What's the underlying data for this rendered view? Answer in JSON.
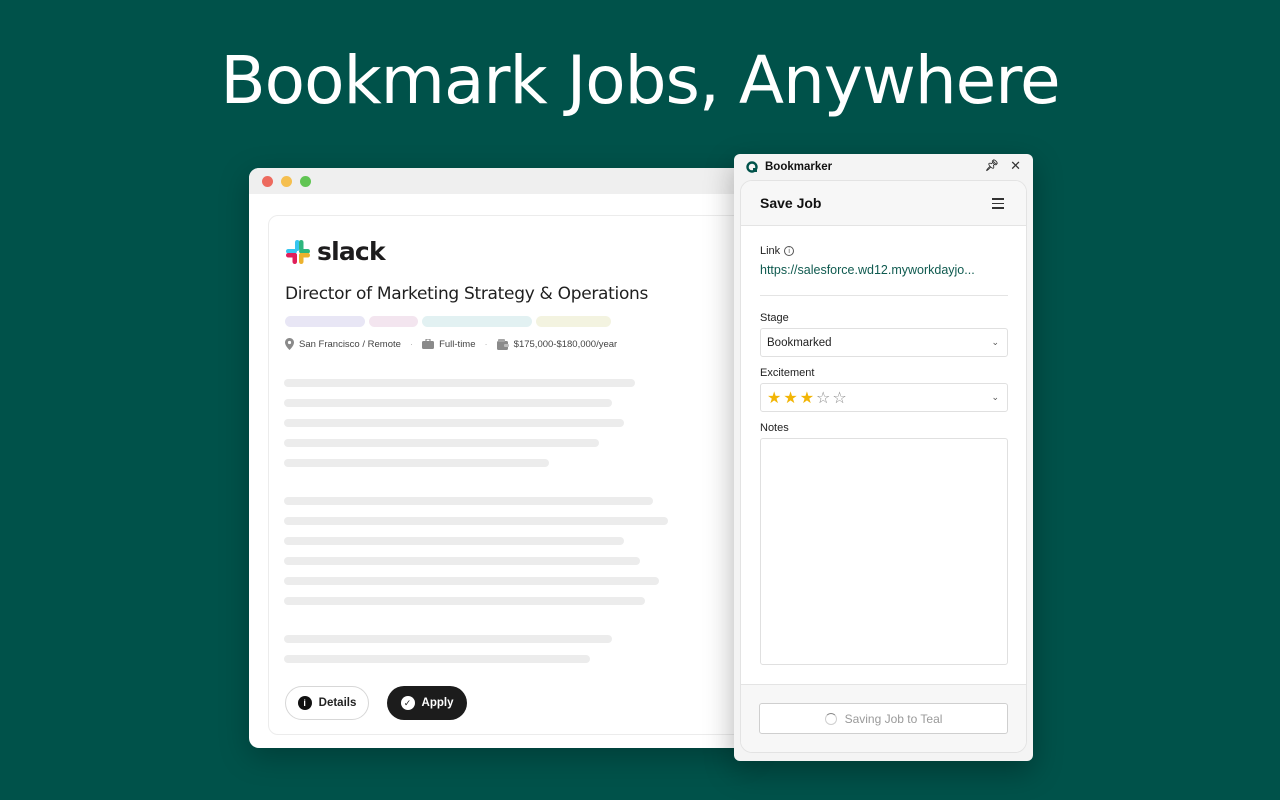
{
  "headline": "Bookmark Jobs, Anywhere",
  "job": {
    "company": "slack",
    "title": "Director of Marketing Strategy & Operations",
    "location": "San Francisco / Remote",
    "employment": "Full-time",
    "salary": "$175,000-$180,000/year",
    "tag_colors": [
      "#e8e6f5",
      "#f3e5ef",
      "#e2f1f2",
      "#f3f3e0"
    ],
    "details_label": "Details",
    "apply_label": "Apply"
  },
  "panel": {
    "app_name": "Bookmarker",
    "header_title": "Save Job",
    "link_label": "Link",
    "link_value": "https://salesforce.wd12.myworkdayjo...",
    "stage_label": "Stage",
    "stage_value": "Bookmarked",
    "excitement_label": "Excitement",
    "excitement_rating": 3,
    "excitement_max": 5,
    "notes_label": "Notes",
    "notes_value": "",
    "save_button_label": "Saving Job to Teal"
  },
  "colors": {
    "background": "#00524a",
    "accent_link": "#0f5a4f",
    "star": "#f2b505"
  }
}
